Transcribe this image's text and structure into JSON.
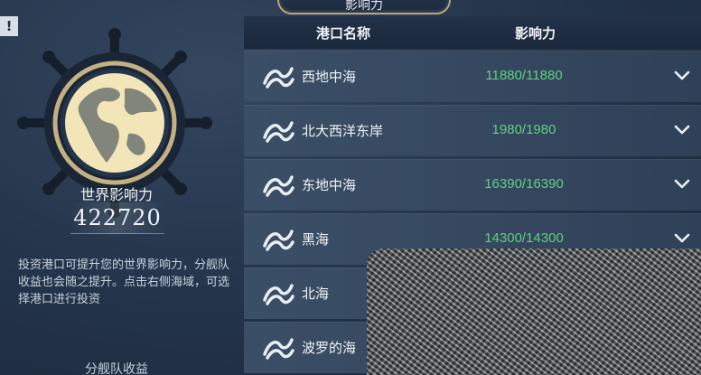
{
  "header": {
    "title": "影响力"
  },
  "left_panel": {
    "alert": "!",
    "world_influence_label": "世界影响力",
    "world_influence_value": "422720",
    "description": "投资港口可提升您的世界影响力，分舰队收益也会随之提升。点击右侧海域，可选择港口进行投资",
    "fleet_income_label": "分舰队收益"
  },
  "table": {
    "columns": [
      "港口名称",
      "影响力"
    ],
    "rows": [
      {
        "name": "西地中海",
        "influence": "11880/11880"
      },
      {
        "name": "北大西洋东岸",
        "influence": "1980/1980"
      },
      {
        "name": "东地中海",
        "influence": "16390/16390"
      },
      {
        "name": "黑海",
        "influence": "14300/14300"
      },
      {
        "name": "北海",
        "influence": ""
      },
      {
        "name": "波罗的海",
        "influence": ""
      }
    ]
  },
  "colors": {
    "influence_text": "#5fd07f",
    "accent_gold": "#bfa67a",
    "background": "#243449"
  },
  "icons": [
    "helm-wheel-globe-icon",
    "port-emblem-icon",
    "chevron-down-icon"
  ]
}
